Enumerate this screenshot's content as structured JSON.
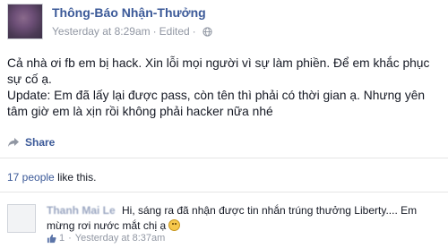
{
  "post": {
    "poster_name": "Thông-Báo Nhận-Thưởng",
    "timestamp": "Yesterday at 8:29am",
    "separator": "·",
    "edited": "Edited",
    "text_line1": "Cả nhà ơi fb em bị hack. Xin lỗi mọi người vì sự làm phiền. Để em khắc phục sự cố ạ.",
    "text_line2": "Update: Em đã lấy lại được pass, còn tên thì phải có thời gian ạ. Nhưng yên tâm giờ em là xịn rồi không phải hacker nữa nhé",
    "share_label": "Share",
    "privacy_icon": "globe-icon",
    "share_icon": "share-arrow-icon"
  },
  "likes": {
    "count": "17 people",
    "suffix": "like this."
  },
  "comment": {
    "commenter_name": "Thanh Mai Le",
    "text": "Hi, sáng ra đã nhận được tin nhắn trúng thưởng Liberty.... Em mừng rơi nước mắt chị ạ",
    "emoji": "smiley-emoji",
    "like_count": "1",
    "separator": "·",
    "timestamp": "Yesterday at 8:37am"
  },
  "colors": {
    "link_blue": "#3b5998",
    "meta_gray": "#9197a3",
    "text": "#141823"
  }
}
